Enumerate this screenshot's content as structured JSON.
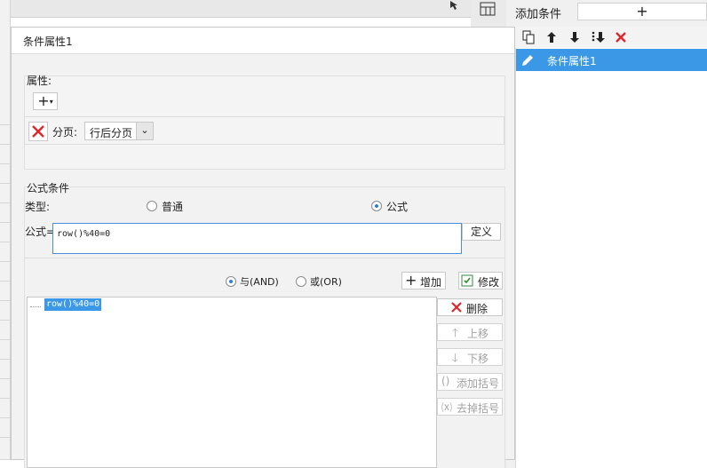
{
  "right_panel": {
    "title": "添加条件",
    "add_label": "+",
    "conditions": [
      {
        "label": "条件属性1",
        "selected": true
      }
    ]
  },
  "dialog": {
    "title": "条件属性1",
    "attributes": {
      "section_label": "属性:",
      "add_label": "+",
      "page_break_label": "分页:",
      "page_break_value": "行后分页"
    },
    "formula_condition": {
      "section_label": "公式条件",
      "type_label": "类型:",
      "type_normal": "普通",
      "type_formula": "公式",
      "selected_type": "公式",
      "formula_label": "公式=",
      "formula_value": "row()%40=0",
      "define_button": "定义",
      "and_label": "与(AND)",
      "or_label": "或(OR)",
      "selected_logic": "AND",
      "add_button": "增加",
      "modify_button": "修改",
      "delete_button": "删除",
      "move_up_button": "上移",
      "move_down_button": "下移",
      "add_bracket_button": "添加括号",
      "remove_bracket_button": "去掉括号",
      "condition_list": [
        "row()%40=0"
      ]
    }
  },
  "colors": {
    "selection_blue": "#3a98e6",
    "delete_red": "#e0262b",
    "input_border": "#4a90d9"
  }
}
